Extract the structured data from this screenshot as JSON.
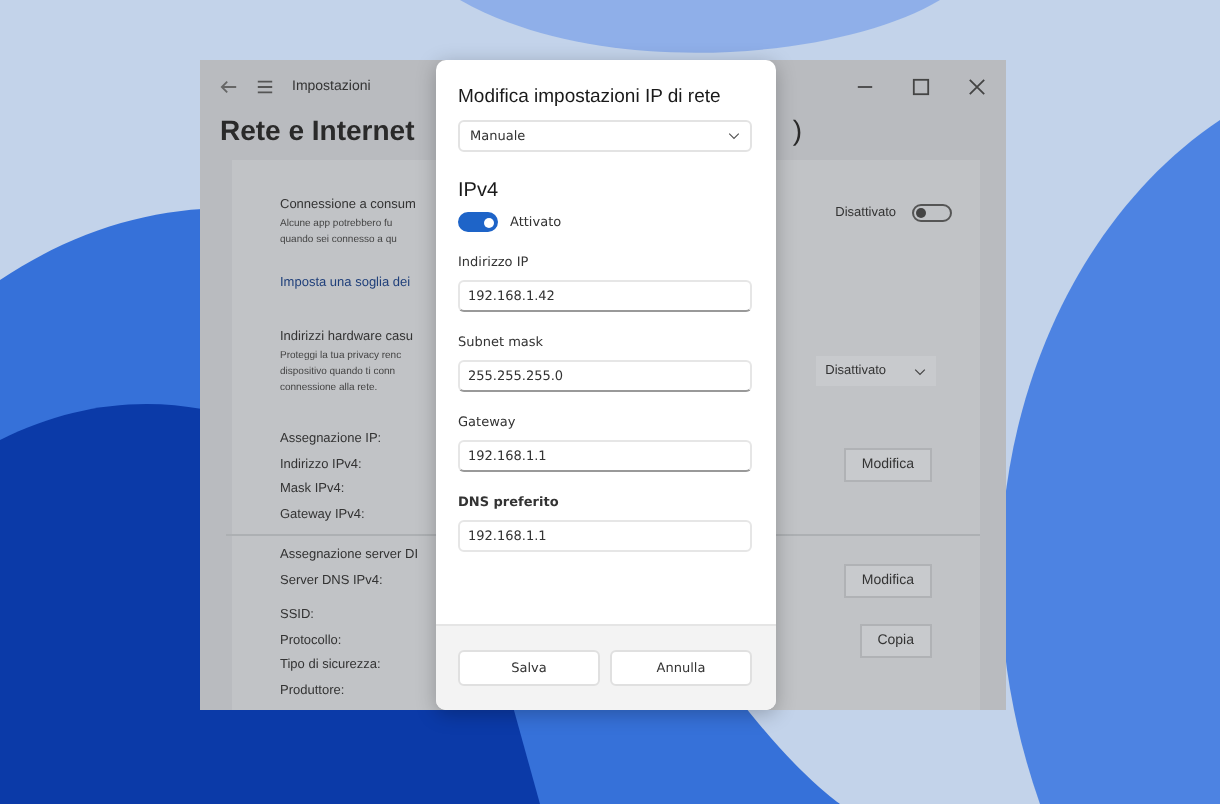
{
  "settings_window": {
    "app_title": "Impostazioni",
    "page_title": "Rete e Internet",
    "title_tail": ")",
    "rows": [
      {
        "kind": "toggle",
        "title": "Connessione a consum",
        "lines": [
          "Alcune app potrebbero fu",
          "quando sei connesso a qu"
        ],
        "control_label": "Disattivato",
        "on": false
      },
      {
        "kind": "link",
        "title": "Imposta una soglia dei"
      },
      {
        "kind": "dropdown",
        "title": "Indirizzi hardware casu",
        "lines": [
          "Proteggi la tua privacy renc",
          "dispositivo quando ti conn",
          "connessione alla rete."
        ],
        "control_label": "Disattivato"
      },
      {
        "kind": "props",
        "lines": [
          "Assegnazione IP:",
          "Indirizzo IPv4:",
          "Mask IPv4:",
          "Gateway IPv4:"
        ],
        "button": "Modifica"
      },
      {
        "kind": "props",
        "lines": [
          "Assegnazione server DI",
          "Server DNS IPv4:"
        ],
        "button": "Modifica"
      },
      {
        "kind": "props",
        "lines": [
          "SSID:",
          "Protocollo:",
          "Tipo di sicurezza:",
          "Produttore:"
        ],
        "button": "Copia"
      }
    ]
  },
  "dialog": {
    "title": "Modifica impostazioni IP di rete",
    "mode": "Manuale",
    "section": "IPv4",
    "toggle": {
      "label": "Attivato",
      "on": true
    },
    "fields": [
      {
        "label": "Indirizzo IP",
        "value": "192.168.1.42",
        "focused": false
      },
      {
        "label": "Subnet mask",
        "value": "255.255.255.0",
        "focused": false
      },
      {
        "label": "Gateway",
        "value": "192.168.1.1",
        "focused": false
      },
      {
        "label": "DNS preferito",
        "value": "192.168.1.1",
        "focused": true
      }
    ],
    "buttons": [
      "Salva",
      "Annulla"
    ]
  }
}
